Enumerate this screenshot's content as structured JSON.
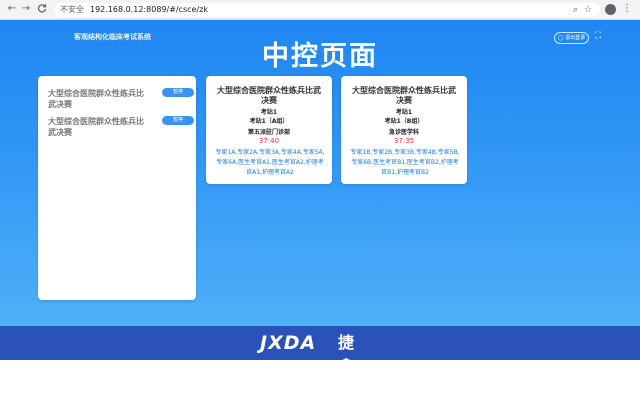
{
  "browser": {
    "back": "←",
    "forward": "→",
    "reload": "C",
    "security": "不安全",
    "url": "192.168.0.12:8089/#/csce/zk",
    "zoom_icon": "search-icon",
    "bookmark_icon": "star-icon"
  },
  "header": {
    "system_name": "客观结构化临床考试系统",
    "title": "中控页面",
    "logout": "◯ 退出登录",
    "fullscreen_icon": "⛶"
  },
  "left_panel": {
    "items": [
      {
        "text": "大型综合医院群众性练兵比武决赛",
        "button": "暂停"
      },
      {
        "text": "大型综合医院群众性练兵比武决赛",
        "button": "暂停"
      }
    ]
  },
  "rooms": [
    {
      "title": "大型综合医院群众性练兵比武决赛",
      "station": "考站1",
      "group": "考站1（A组）",
      "dept": "第五派驻门诊部",
      "time": "37:40",
      "staff": "专家1A,专家2A,专家3A,专家4A,专家5A,专家6A,医生考官A1,医生考官A2,护理考官A1,护理考官A2"
    },
    {
      "title": "大型综合医院群众性练兵比武决赛",
      "station": "考站1",
      "group": "考站1（B组）",
      "dept": "急诊医学科",
      "time": "37:35",
      "staff": "专家1B,专家2B,专家3B,专家4B,专家5B,专家6B,医生考官B1,医生考官B2,护理考官B1,护理考官B2"
    }
  ],
  "footer": {
    "logo_en": "JXDA",
    "logo_cn": "捷鑫达"
  }
}
